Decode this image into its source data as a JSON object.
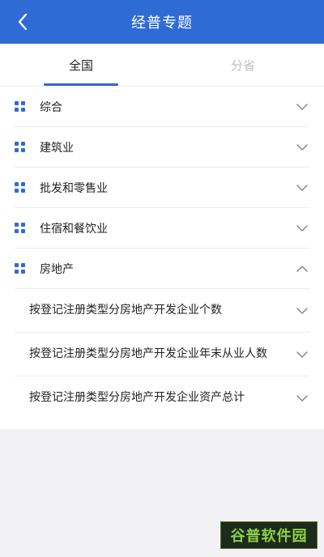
{
  "header": {
    "title": "经普专题"
  },
  "tabs": [
    {
      "label": "全国",
      "active": true
    },
    {
      "label": "分省",
      "active": false
    }
  ],
  "categories": [
    {
      "label": "综合",
      "expanded": false
    },
    {
      "label": "建筑业",
      "expanded": false
    },
    {
      "label": "批发和零售业",
      "expanded": false
    },
    {
      "label": "住宿和餐饮业",
      "expanded": false
    },
    {
      "label": "房地产",
      "expanded": true
    }
  ],
  "real_estate_items": [
    {
      "label": "按登记注册类型分房地产开发企业个数"
    },
    {
      "label": "按登记注册类型分房地产开发企业年末从业人数"
    },
    {
      "label": "按登记注册类型分房地产开发企业资产总计"
    }
  ],
  "watermark": {
    "text": "谷普软件园"
  },
  "colors": {
    "accent": "#2f6bd4",
    "background": "#f2f2f5",
    "inactive_tab": "#c0c0c0"
  },
  "icons": {
    "back": "chevron-left-icon",
    "category": "grid-icon",
    "collapsed": "chevron-down-icon",
    "expanded": "chevron-up-icon"
  }
}
